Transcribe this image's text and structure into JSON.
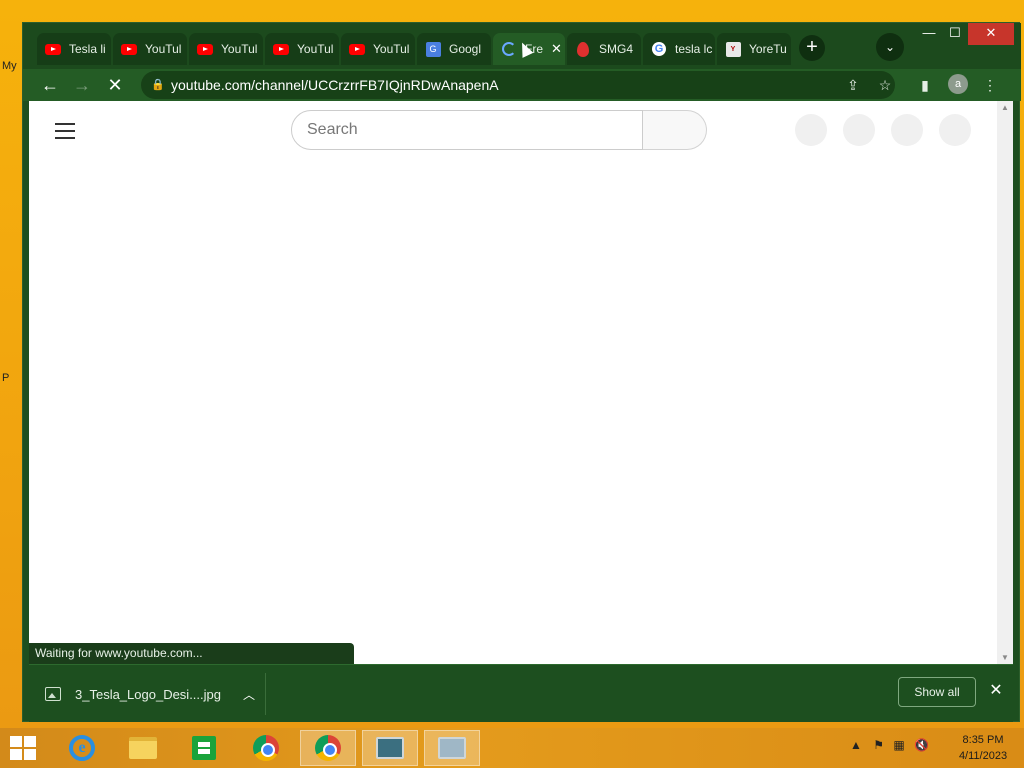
{
  "desktop": {
    "labels": [
      "My",
      "P"
    ]
  },
  "browser": {
    "tabs": [
      {
        "label": "Tesla li",
        "icon": "youtube-icon",
        "active": false
      },
      {
        "label": "YouTul",
        "icon": "youtube-icon",
        "active": false
      },
      {
        "label": "YouTul",
        "icon": "youtube-icon",
        "active": false
      },
      {
        "label": "YouTul",
        "icon": "youtube-icon",
        "active": false
      },
      {
        "label": "YouTul",
        "icon": "youtube-icon",
        "active": false
      },
      {
        "label": "Googl",
        "icon": "google-translate-icon",
        "active": false
      },
      {
        "label": "Fre",
        "icon": "loading-spinner-icon",
        "active": true
      },
      {
        "label": "SMG4",
        "icon": "fire-icon",
        "active": false
      },
      {
        "label": "tesla lc",
        "icon": "google-icon",
        "active": false
      },
      {
        "label": "YoreTu",
        "icon": "yore-icon",
        "active": false
      }
    ],
    "new_tab_symbol": "+",
    "tab_search_symbol": "⌄",
    "url": "youtube.com/channel/UCCrzrrFB7IQjnRDwAnapenA",
    "avatar_letter": "a",
    "window_controls": {
      "minimize": "—",
      "maximize": "☐",
      "close": "✕"
    }
  },
  "page": {
    "search_placeholder": "Search"
  },
  "status_text": "Waiting for www.youtube.com...",
  "downloads": {
    "file_name": "3_Tesla_Logo_Desi....jpg",
    "show_all_label": "Show all"
  },
  "taskbar": {
    "time": "8:35 PM",
    "date": "4/11/2023"
  },
  "colors": {
    "browser_theme": "#1d4f1f",
    "taskbar": "#e49b1c",
    "desktop": "#f3a50f"
  }
}
